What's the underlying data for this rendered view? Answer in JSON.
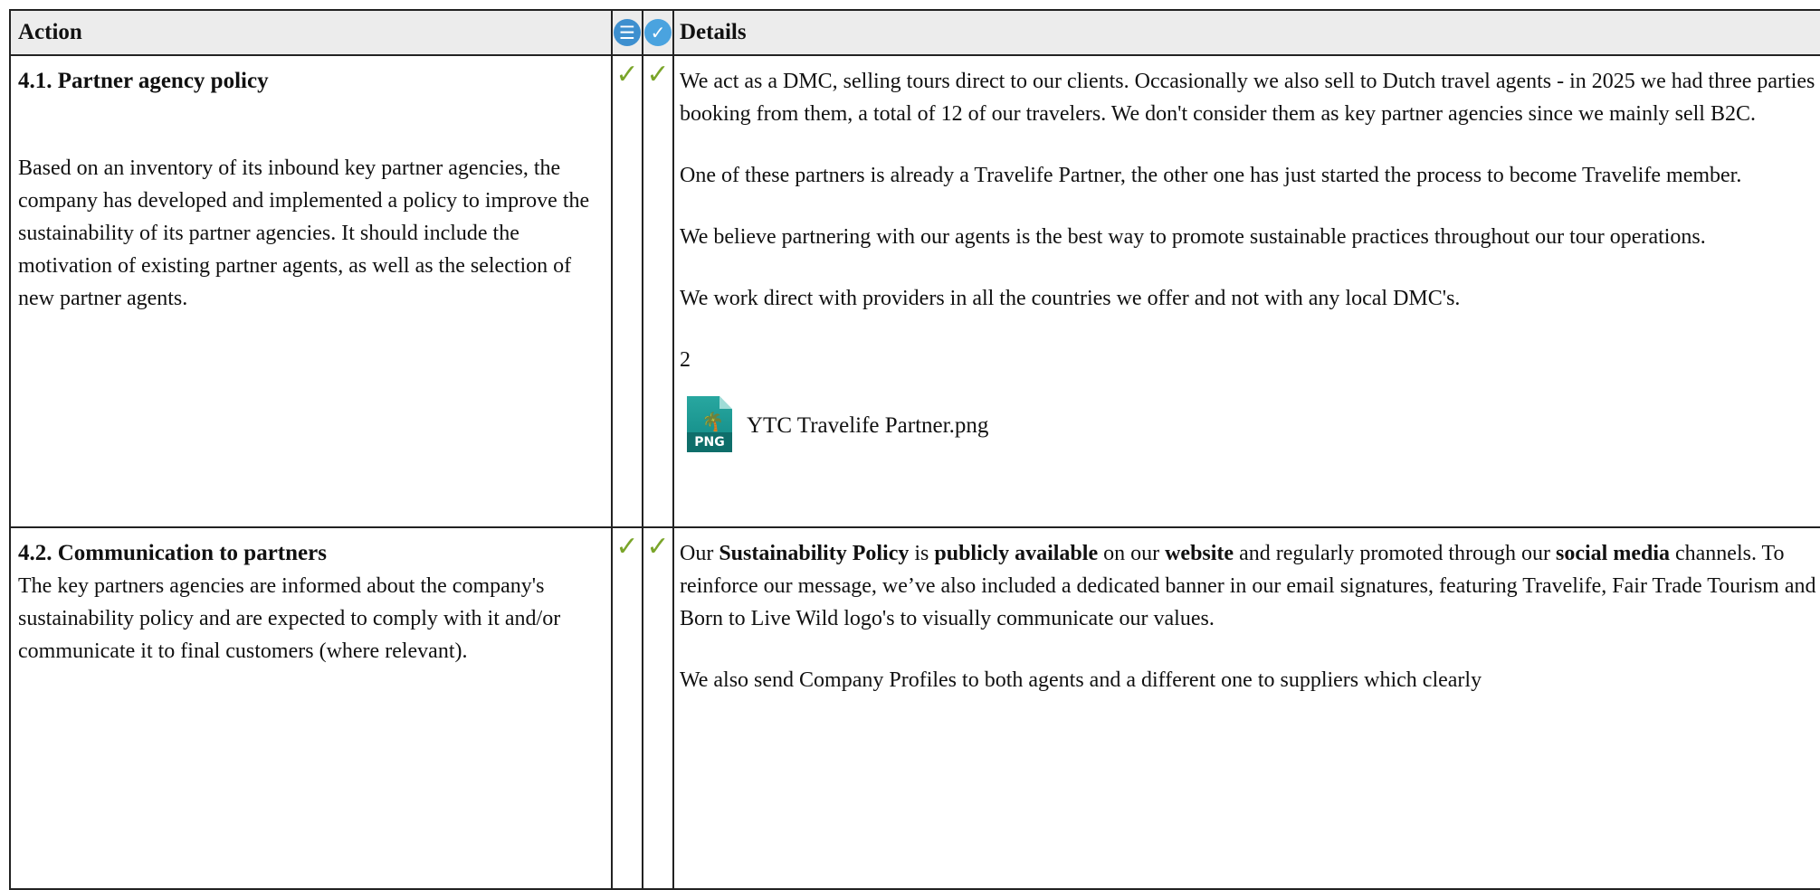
{
  "header": {
    "action": "Action",
    "details": "Details",
    "icon1": "list-icon",
    "icon2": "check-circle-icon"
  },
  "rows": [
    {
      "title": "4.1. Partner agency policy",
      "description": "Based on an inventory of its inbound key partner agencies, the company has developed and implemented a policy to improve the sustainability of its partner agencies. It should include the motivation of existing partner agents, as well as the selection of new partner agents.",
      "check1": "✓",
      "check2": "✓",
      "details": [
        "We act as a DMC, selling tours direct to our clients. Occasionally we also sell to Dutch travel agents - in 2025 we had three parties booking from them, a total of 12 of our travelers. We don't consider them as key partner agencies since we mainly sell B2C.",
        "One of these partners is already a Travelife Partner, the other one has just started the process to become Travelife member.",
        "We believe partnering with our agents is the best way to promote sustainable practices throughout our tour operations.",
        "We work direct with providers in all the countries we offer and not with any local DMC's.",
        "2"
      ],
      "attachment": {
        "badge": "PNG",
        "name": "YTC Travelife Partner.png"
      }
    },
    {
      "title": "4.2. Communication to partners",
      "description": "The key partners agencies are informed about the company's sustainability policy and are expected to comply with it and/or communicate it to final customers (where relevant).",
      "check1": "✓",
      "check2": "✓",
      "details_p1": {
        "t1": "Our ",
        "b1": "Sustainability Policy",
        "t2": " is ",
        "b2": "publicly available",
        "t3": " on our ",
        "b3": "website",
        "t4": " and regularly promoted through our ",
        "b4": "social media",
        "t5": " channels. To reinforce our message, we’ve also included a dedicated banner in our email signatures, featuring Travelife, Fair Trade Tourism and Born to Live Wild logo's to visually communicate our values."
      },
      "details_p2": "We also send Company Profiles to both agents and a different one to suppliers which clearly"
    }
  ]
}
